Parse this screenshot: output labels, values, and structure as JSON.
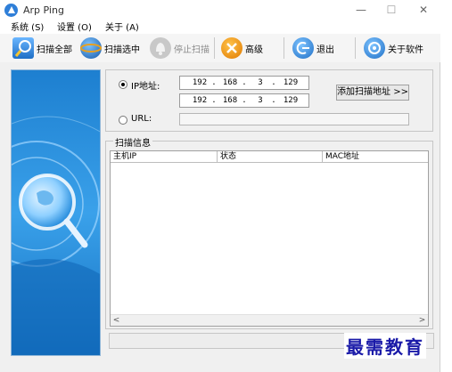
{
  "window": {
    "title": "Arp Ping",
    "min_glyph": "—",
    "max_glyph": "☐",
    "close_glyph": "✕"
  },
  "menu": {
    "items": [
      "系统 (S)",
      "设置 (O)",
      "关于 (A)"
    ]
  },
  "toolbar": {
    "scan_all": "扫描全部",
    "scan_selected": "扫描选中",
    "stop_scan": "停止扫描",
    "advanced": "高级",
    "exit": "退出",
    "about": "关于软件"
  },
  "form": {
    "ip_label": "IP地址:",
    "url_label": "URL:",
    "ip_selected": true,
    "ip_start": [
      "192",
      "168",
      "3",
      "129"
    ],
    "ip_end": [
      "192",
      "168",
      "3",
      "129"
    ],
    "url_value": "",
    "add_button": "添加扫描地址 >>"
  },
  "scan_info": {
    "title": "扫描信息",
    "columns": [
      "主机IP",
      "状态",
      "MAC地址"
    ],
    "rows": []
  },
  "hscroll": {
    "left_arrow": "<",
    "right_arrow": ">"
  },
  "watermark": "最需教育",
  "colors": {
    "accent": "#2f7fd8",
    "sidebar": "#1a86d6",
    "watermark": "#1a1aa8"
  }
}
